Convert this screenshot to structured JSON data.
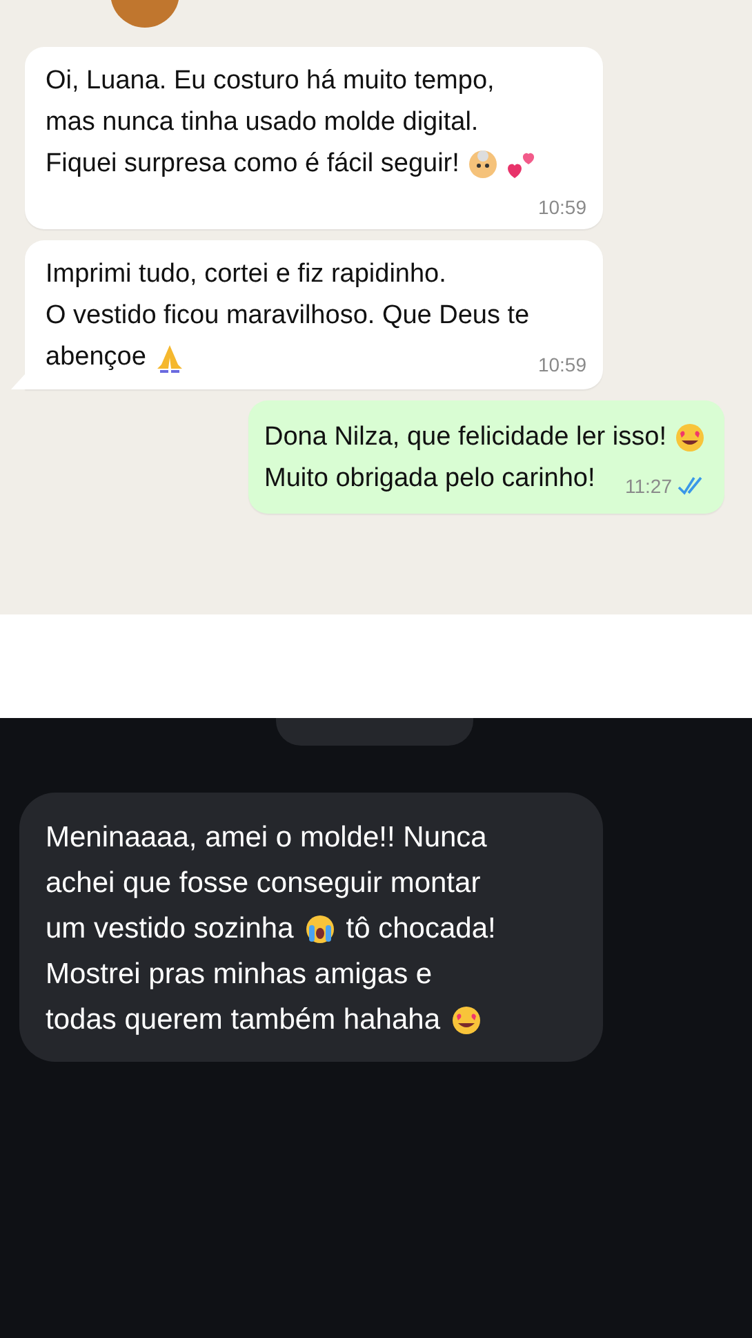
{
  "chat_light": {
    "messages": [
      {
        "kind": "incoming",
        "tail": false,
        "lines": [
          {
            "text": "Oi, Luana. Eu costuro há muito tempo,"
          },
          {
            "text": "mas nunca tinha usado molde digital."
          },
          {
            "text": "Fiquei surpresa como é fácil seguir!",
            "emojis": [
              {
                "kind": "grandma"
              },
              {
                "kind": "hearts"
              }
            ]
          }
        ],
        "time": "10:59",
        "time_below": true
      },
      {
        "kind": "incoming",
        "tail": true,
        "lines": [
          {
            "text": "Imprimi tudo, cortei e fiz rapidinho."
          },
          {
            "text": "O vestido ficou maravilhoso. Que Deus te"
          },
          {
            "text": "abençoe",
            "emojis": [
              {
                "kind": "praying"
              }
            ]
          }
        ],
        "time": "10:59",
        "time_below": false
      },
      {
        "kind": "outgoing",
        "tail": false,
        "lines": [
          {
            "text": "Dona Nilza, que felicidade ler isso!",
            "emojis": [
              {
                "kind": "heart-eyes"
              }
            ]
          },
          {
            "text": "Muito obrigada pelo carinho!"
          }
        ],
        "time": "11:27",
        "read": true,
        "time_below": false
      }
    ]
  },
  "chat_dark": {
    "message": {
      "lines": [
        {
          "text": "Meninaaaa, amei o molde!! Nunca"
        },
        {
          "text": "achei que fosse conseguir montar"
        },
        {
          "text": "um vestido sozinha",
          "emojis": [
            {
              "kind": "crying"
            }
          ],
          "after": "tô chocada!"
        },
        {
          "text": "Mostrei pras minhas amigas e"
        },
        {
          "text": "todas querem também hahaha",
          "emojis": [
            {
              "kind": "heart-eyes"
            }
          ]
        }
      ]
    }
  }
}
